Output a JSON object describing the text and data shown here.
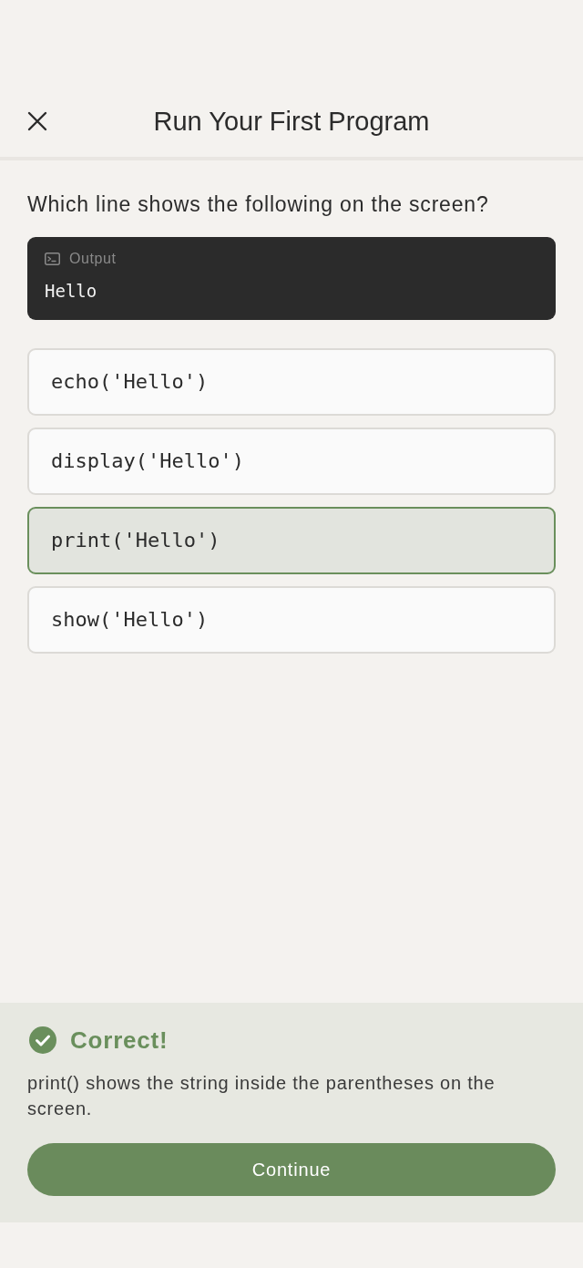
{
  "header": {
    "title": "Run Your First Program"
  },
  "question": "Which line shows the following on the screen?",
  "output_panel": {
    "label": "Output",
    "text": "Hello"
  },
  "options": [
    {
      "code": "echo('Hello')",
      "selected": false
    },
    {
      "code": "display('Hello')",
      "selected": false
    },
    {
      "code": "print('Hello')",
      "selected": true
    },
    {
      "code": "show('Hello')",
      "selected": false
    }
  ],
  "feedback": {
    "kind": "correct",
    "heading": "Correct!",
    "explanation": "print() shows the string inside the parentheses on the screen.",
    "button": "Continue"
  }
}
